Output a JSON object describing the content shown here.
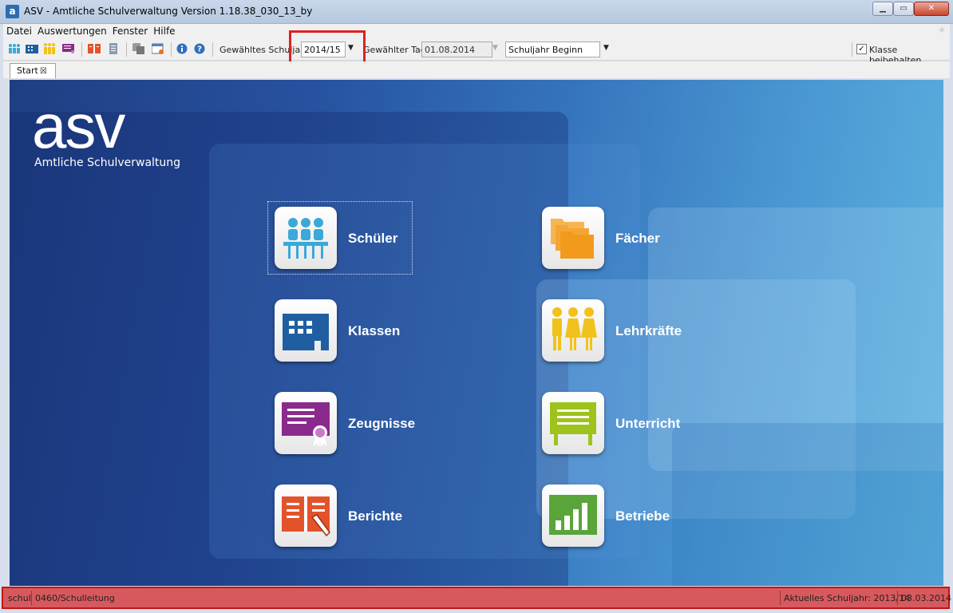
{
  "window": {
    "app_icon": "a",
    "title": "ASV - Amtliche Schulverwaltung Version 1.18.38_030_13_by",
    "controls": [
      "minimize",
      "maximize",
      "close"
    ]
  },
  "menu": [
    "Datei",
    "Auswertungen",
    "Fenster",
    "Hilfe"
  ],
  "toolbar": {
    "schuljahr_label": "Gewähltes Schuljahr",
    "schuljahr_value": "2014/15",
    "tag_label": "Gewählter Tag",
    "tag_value": "01.08.2014",
    "zeitpunkt_value": "Schuljahr Beginn",
    "klasse_label": "Klasse beibehalten",
    "klasse_checked": true
  },
  "tabs": [
    {
      "label": "Start",
      "active": true
    }
  ],
  "start": {
    "logo": "asv",
    "logo_subtitle": "Amtliche Schulverwaltung",
    "modules": [
      {
        "label": "Schüler",
        "icon": "students-icon",
        "color": "#3aa9d8"
      },
      {
        "label": "Fächer",
        "icon": "folders-icon",
        "color": "#f29a1c"
      },
      {
        "label": "Klassen",
        "icon": "classroom-icon",
        "color": "#1f5fa1"
      },
      {
        "label": "Lehrkräfte",
        "icon": "teachers-icon",
        "color": "#f2c21c"
      },
      {
        "label": "Zeugnisse",
        "icon": "certificate-icon",
        "color": "#8a2a8c"
      },
      {
        "label": "Unterricht",
        "icon": "blackboard-icon",
        "color": "#9ec31c"
      },
      {
        "label": "Berichte",
        "icon": "report-book-icon",
        "color": "#e3532a"
      },
      {
        "label": "Betriebe",
        "icon": "bar-chart-icon",
        "color": "#5aa53a"
      }
    ]
  },
  "status": {
    "user": "schul",
    "role": "0460/Schulleitung",
    "current_year": "Aktuelles Schuljahr: 2013/14",
    "date": "03.03.2014"
  }
}
